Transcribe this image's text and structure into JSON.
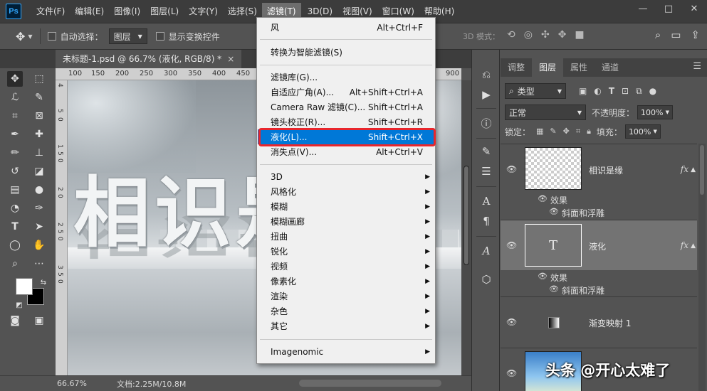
{
  "app": {
    "logo": "Ps"
  },
  "menubar": {
    "items": [
      "文件(F)",
      "编辑(E)",
      "图像(I)",
      "图层(L)",
      "文字(Y)",
      "选择(S)",
      "滤镜(T)",
      "3D(D)",
      "视图(V)",
      "窗口(W)",
      "帮助(H)"
    ],
    "active": "滤镜(T)",
    "window_controls": [
      "—",
      "□",
      "✕"
    ]
  },
  "options": {
    "auto_select_label": "自动选择：",
    "auto_select_target": "图层",
    "show_transform_label": "显示变换控件",
    "mode_3d_label": "3D 模式："
  },
  "document": {
    "tab_title": "未标题-1.psd @ 66.7% (液化, RGB/8) *",
    "close": "×",
    "ruler_h": [
      "100",
      "150",
      "200",
      "250",
      "300",
      "350",
      "400",
      "450",
      "900"
    ],
    "ruler_v": [
      "4",
      "5",
      "0",
      "1",
      "5",
      "0",
      "2",
      "0",
      "2",
      "5",
      "0",
      "3",
      "5",
      "0"
    ],
    "canvas_text": "相识是缘"
  },
  "status": {
    "zoom": "66.67%",
    "doc_size": "文档:2.25M/10.8M"
  },
  "filter_menu": {
    "items": [
      {
        "label": "风",
        "shortcut": "Alt+Ctrl+F"
      },
      {
        "label": "转换为智能滤镜(S)",
        "shortcut": ""
      },
      {
        "label": "滤镜库(G)...",
        "shortcut": ""
      },
      {
        "label": "自适应广角(A)...",
        "shortcut": "Alt+Shift+Ctrl+A"
      },
      {
        "label": "Camera Raw 滤镜(C)...",
        "shortcut": "Shift+Ctrl+A"
      },
      {
        "label": "镜头校正(R)...",
        "shortcut": "Shift+Ctrl+R"
      },
      {
        "label": "液化(L)...",
        "shortcut": "Shift+Ctrl+X"
      },
      {
        "label": "消失点(V)...",
        "shortcut": "Alt+Ctrl+V"
      },
      {
        "label": "3D",
        "shortcut": ""
      },
      {
        "label": "风格化",
        "shortcut": ""
      },
      {
        "label": "模糊",
        "shortcut": ""
      },
      {
        "label": "模糊画廊",
        "shortcut": ""
      },
      {
        "label": "扭曲",
        "shortcut": ""
      },
      {
        "label": "锐化",
        "shortcut": ""
      },
      {
        "label": "视频",
        "shortcut": ""
      },
      {
        "label": "像素化",
        "shortcut": ""
      },
      {
        "label": "渲染",
        "shortcut": ""
      },
      {
        "label": "杂色",
        "shortcut": ""
      },
      {
        "label": "其它",
        "shortcut": ""
      },
      {
        "label": "Imagenomic",
        "shortcut": ""
      }
    ],
    "highlighted": "液化(L)...",
    "highlight_color": "#0078d7",
    "callout_color": "#e8262c"
  },
  "layers_panel": {
    "tabs": [
      "调整",
      "图层",
      "属性",
      "通道"
    ],
    "active_tab": "图层",
    "kind_label": "类型",
    "blend_mode": "正常",
    "opacity_label": "不透明度：",
    "opacity_value": "100%",
    "lock_label": "锁定：",
    "fill_label": "填充：",
    "fill_value": "100%",
    "layers": [
      {
        "name": "相识是缘",
        "fx": "fx",
        "effects_label": "效果",
        "effect": "斜面和浮雕",
        "selected": false
      },
      {
        "name": "液化",
        "fx": "fx",
        "effects_label": "效果",
        "effect": "斜面和浮雕",
        "selected": true,
        "thumb_letter": "T"
      },
      {
        "name": "渐变映射 1",
        "selected": false
      }
    ]
  },
  "watermark": "头条 @开心太难了"
}
